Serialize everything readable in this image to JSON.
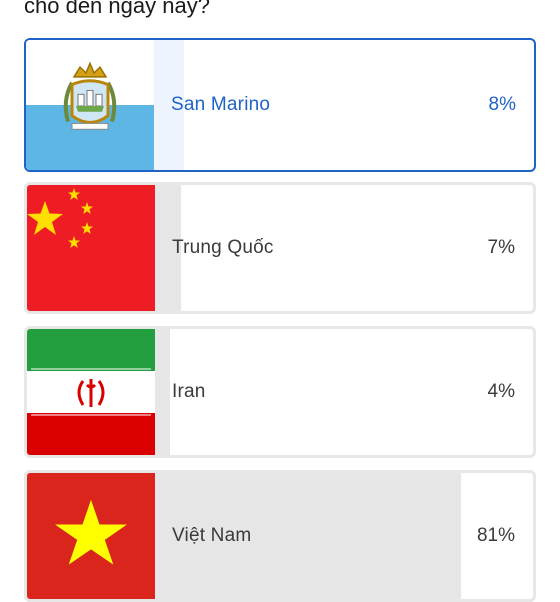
{
  "question": {
    "text": "cho đến ngày nay?"
  },
  "options": [
    {
      "label": "San Marino",
      "percent": "8%",
      "share": 0.08,
      "selected": true,
      "flag_icon": "san-marino-flag-icon"
    },
    {
      "label": "Trung Quốc",
      "percent": "7%",
      "share": 0.07,
      "selected": false,
      "flag_icon": "china-flag-icon"
    },
    {
      "label": "Iran",
      "percent": "4%",
      "share": 0.04,
      "selected": false,
      "flag_icon": "iran-flag-icon"
    },
    {
      "label": "Việt Nam",
      "percent": "81%",
      "share": 0.81,
      "selected": false,
      "flag_icon": "vietnam-flag-icon"
    }
  ],
  "colors": {
    "accent": "#1f63c6",
    "selected_fill": "#eef4fd",
    "bar_fill": "#e6e6e6",
    "card_border": "#e7e7e7",
    "text": "#3a3a3a"
  }
}
